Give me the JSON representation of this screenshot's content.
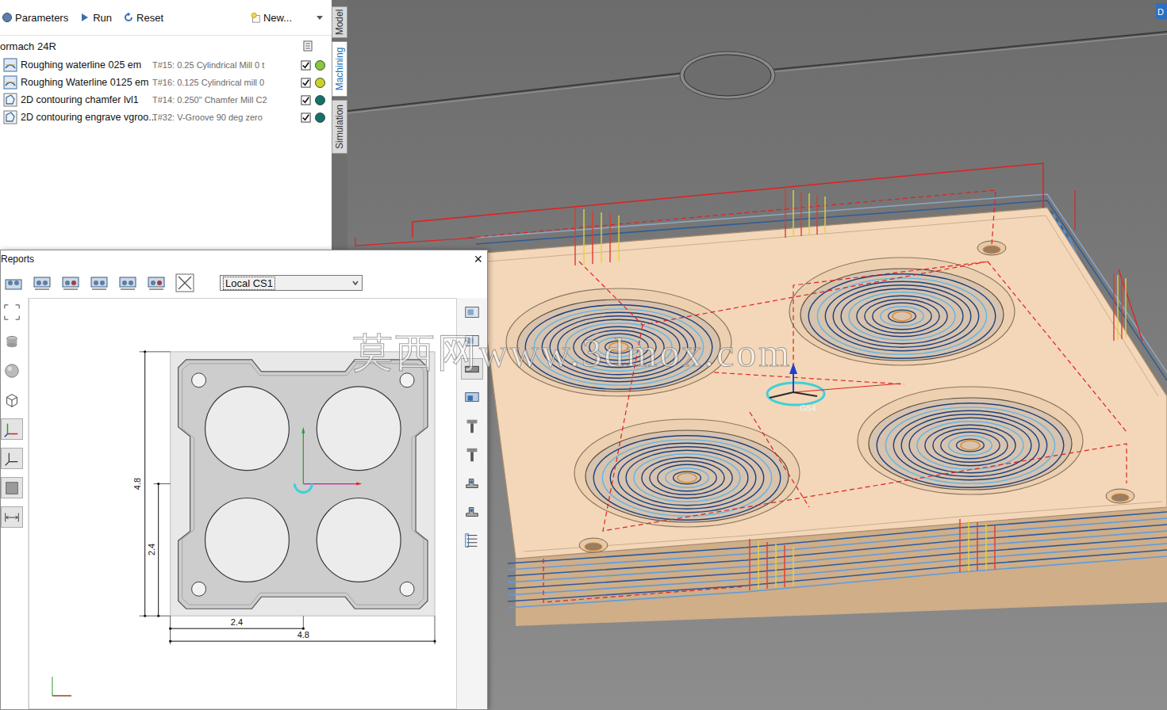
{
  "toolbar": [
    {
      "label": "Parameters",
      "kind": "params"
    },
    {
      "label": "Run",
      "kind": "run"
    },
    {
      "label": "Reset",
      "kind": "reset"
    },
    {
      "label": "New...",
      "kind": "new"
    }
  ],
  "tree": {
    "root": "ormach 24R",
    "operations": [
      {
        "name": "Roughing waterline 025 em",
        "tool": "T#15: 0.25 Cylindrical Mill 0 t",
        "kind": "waterline",
        "checked": true,
        "color": "#8cc63f"
      },
      {
        "name": "Roughing Waterline 0125 em",
        "tool": "T#16: 0.125 Cylindrical mill 0",
        "kind": "waterline",
        "checked": true,
        "color": "#c9d12b"
      },
      {
        "name": "2D contouring chamfer lvl1",
        "tool": "T#14: 0.250\" Chamfer Mill C2",
        "kind": "contour",
        "checked": true,
        "color": "#17706f"
      },
      {
        "name": "2D contouring engrave vgroo...",
        "tool": "T#32: V-Groove 90 deg zero",
        "kind": "contour",
        "checked": true,
        "color": "#17706f"
      }
    ]
  },
  "side_tabs": [
    {
      "label": "Model",
      "selected": false
    },
    {
      "label": "Machining",
      "selected": true
    },
    {
      "label": "Simulation",
      "selected": false
    }
  ],
  "viewport": {
    "origin_label": "G54",
    "corner_tab": "D"
  },
  "reports": {
    "title": "Reports",
    "close": "×",
    "coordinate_system": "Local CS1",
    "dimensions": [
      {
        "label": "4.8",
        "kind": "vertical"
      },
      {
        "label": "2.4",
        "kind": "vertical"
      },
      {
        "label": "2.4",
        "kind": "horizontal"
      },
      {
        "label": "4.8",
        "kind": "horizontal"
      }
    ]
  },
  "watermark": "莫西网www.3dmox.com"
}
